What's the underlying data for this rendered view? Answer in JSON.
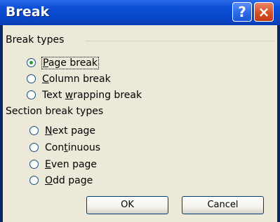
{
  "window": {
    "title": "Break",
    "help_glyph": "?",
    "close_glyph": "×"
  },
  "break_types": {
    "label": "Break types",
    "options": [
      {
        "pre": "",
        "accel": "P",
        "post": "age break",
        "selected": true
      },
      {
        "pre": "",
        "accel": "C",
        "post": "olumn break",
        "selected": false
      },
      {
        "pre": "Text ",
        "accel": "w",
        "post": "rapping break",
        "selected": false
      }
    ]
  },
  "section_break_types": {
    "label": "Section break types",
    "options": [
      {
        "pre": "",
        "accel": "N",
        "post": "ext page",
        "selected": false
      },
      {
        "pre": "Con",
        "accel": "t",
        "post": "inuous",
        "selected": false
      },
      {
        "pre": "",
        "accel": "E",
        "post": "ven page",
        "selected": false
      },
      {
        "pre": "",
        "accel": "O",
        "post": "dd page",
        "selected": false
      }
    ]
  },
  "buttons": {
    "ok": "OK",
    "cancel": "Cancel"
  },
  "colors": {
    "titlebar": "#0846c8",
    "dialog_bg": "#ece9d8",
    "radio_dot": "#2e9a35",
    "close_button": "#d9532a"
  }
}
